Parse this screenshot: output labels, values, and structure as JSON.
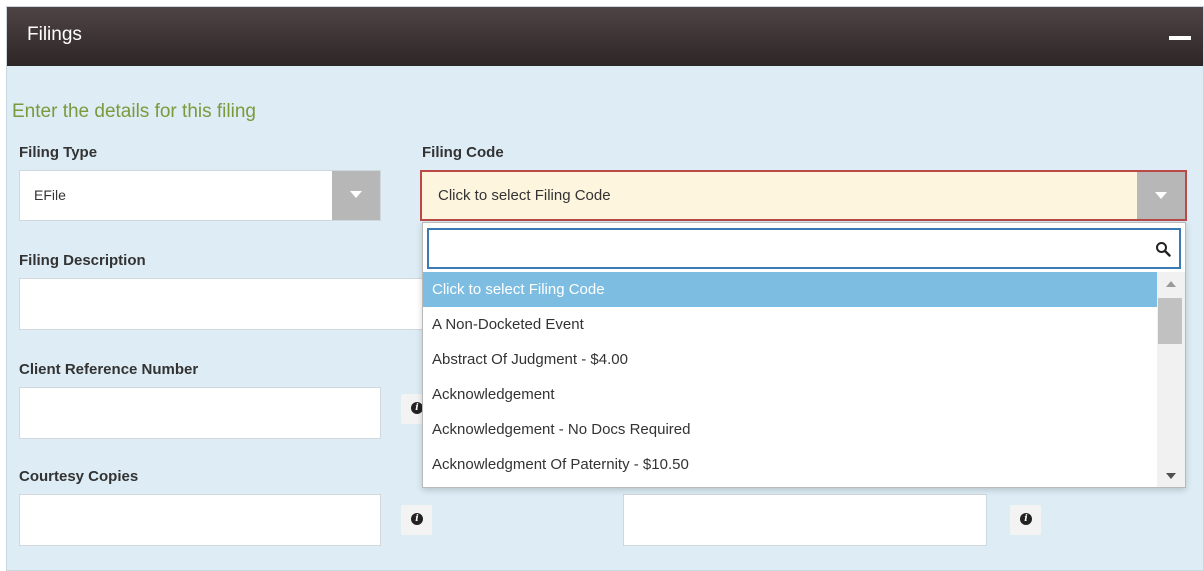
{
  "panel": {
    "title": "Filings"
  },
  "form": {
    "heading": "Enter the details for this filing",
    "filing_type": {
      "label": "Filing Type",
      "value": "EFile"
    },
    "filing_code": {
      "label": "Filing Code",
      "value": "Click to select Filing Code"
    },
    "filing_description": {
      "label": "Filing Description",
      "value": ""
    },
    "client_reference": {
      "label": "Client Reference Number",
      "value": ""
    },
    "courtesy_copies": {
      "label": "Courtesy Copies",
      "value": ""
    },
    "unlabeled_field": {
      "value": ""
    }
  },
  "dropdown": {
    "search_value": "",
    "items": [
      "Click to select Filing Code",
      "A Non-Docketed Event",
      "Abstract Of Judgment - $4.00",
      "Acknowledgement",
      "Acknowledgement - No Docs Required",
      "Acknowledgment Of Paternity - $10.50"
    ],
    "highlighted_index": 0
  },
  "colors": {
    "header": "#3a3132",
    "panel_bg": "#ddecf5",
    "heading_green": "#7b9a3d",
    "error_border": "#b94a48",
    "open_select_bg": "#fdf5dd",
    "highlight": "#7dbde2"
  },
  "icons": [
    "minus-icon",
    "chevron-down-icon",
    "search-icon",
    "info-icon"
  ]
}
